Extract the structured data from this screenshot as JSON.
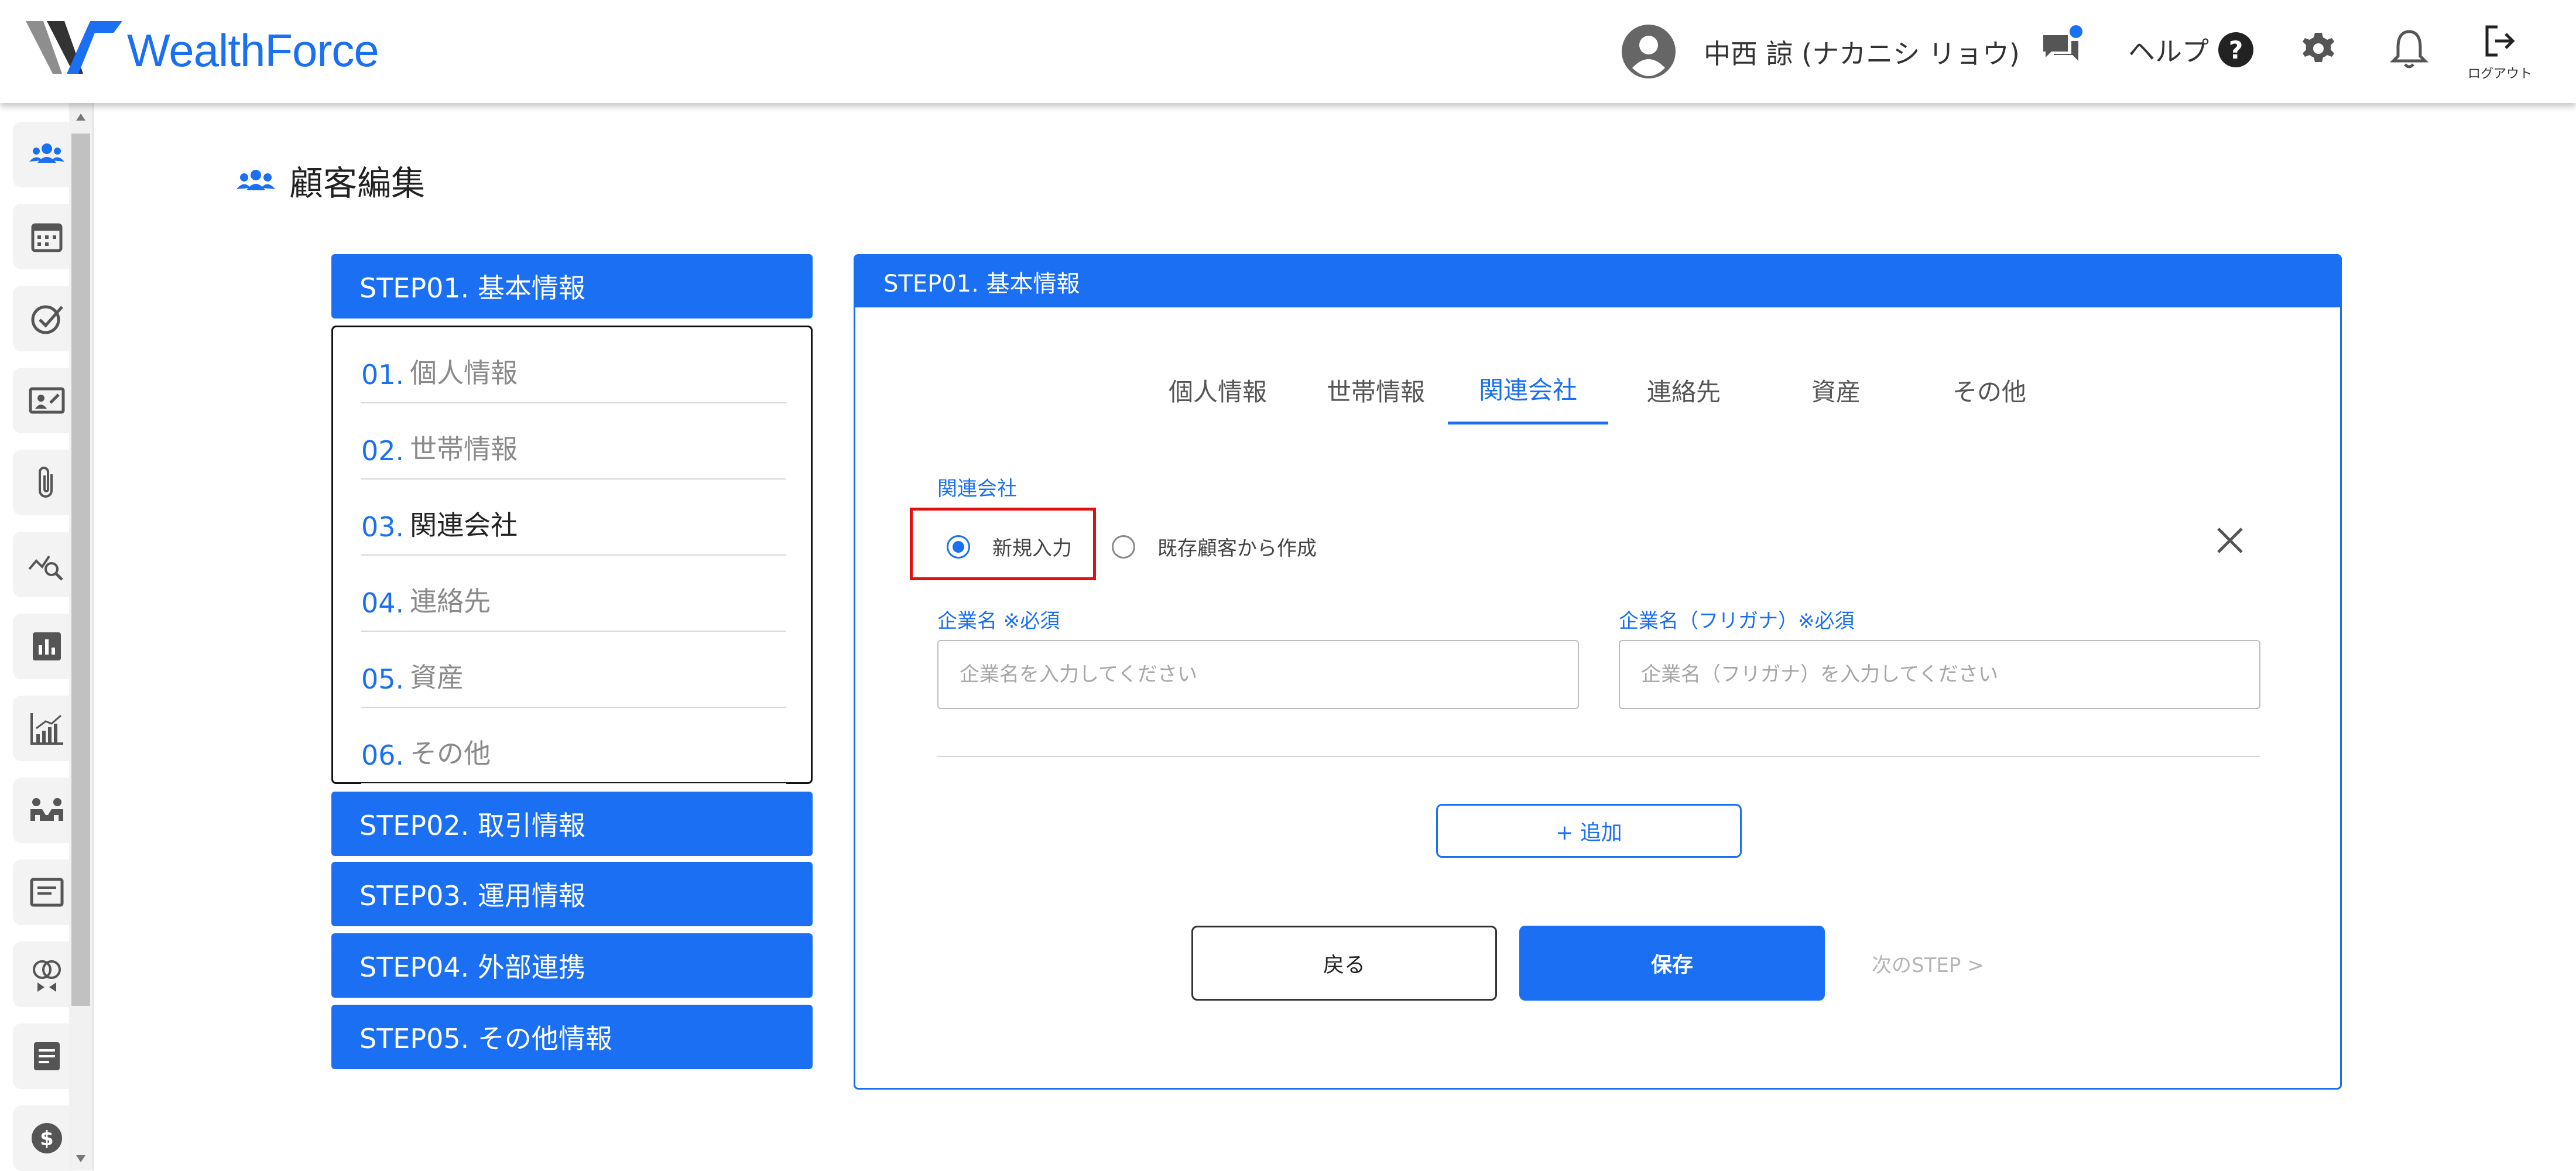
{
  "app": {
    "logo_text": "WealthForce"
  },
  "header": {
    "user_name": "中西 諒 (ナカニシ リョウ)",
    "help_label": "ヘルプ",
    "help_symbol": "?",
    "logout_label": "ログアウト",
    "chat_badge_color": "#1a6ff3"
  },
  "sidebar": {
    "icons": [
      "people-icon",
      "calendar-icon",
      "check-circle-icon",
      "id-card-icon",
      "paperclip-icon",
      "chart-search-icon",
      "bar-chart-icon",
      "growth-chart-icon",
      "meeting-icon",
      "document-icon",
      "rings-icon",
      "notes-icon",
      "dollar-icon"
    ]
  },
  "page": {
    "title": "顧客編集"
  },
  "steps": {
    "step1": "STEP01. 基本情報",
    "step2": "STEP02. 取引情報",
    "step3": "STEP03. 運用情報",
    "step4": "STEP04. 外部連携",
    "step5": "STEP05. その他情報",
    "substeps": [
      {
        "num": "01.",
        "label": "個人情報"
      },
      {
        "num": "02.",
        "label": "世帯情報"
      },
      {
        "num": "03.",
        "label": "関連会社"
      },
      {
        "num": "04.",
        "label": "連絡先"
      },
      {
        "num": "05.",
        "label": "資産"
      },
      {
        "num": "06.",
        "label": "その他"
      }
    ],
    "active_substep": "03."
  },
  "panel": {
    "title": "STEP01. 基本情報",
    "tabs": [
      "個人情報",
      "世帯情報",
      "関連会社",
      "連絡先",
      "資産",
      "その他"
    ],
    "active_tab": "関連会社",
    "section_label": "関連会社",
    "radio_new": "新規入力",
    "radio_existing": "既存顧客から作成",
    "radio_selected": "新規入力",
    "company_name_label": "企業名 ※必須",
    "company_name_placeholder": "企業名を入力してください",
    "company_kana_label": "企業名（フリガナ）※必須",
    "company_kana_placeholder": "企業名（フリガナ）を入力してください",
    "add_button": "+ 追加",
    "back_button": "戻る",
    "save_button": "保存",
    "next_step": "次のSTEP >"
  },
  "colors": {
    "accent": "#1a6ff3",
    "highlight": "#e01010"
  }
}
